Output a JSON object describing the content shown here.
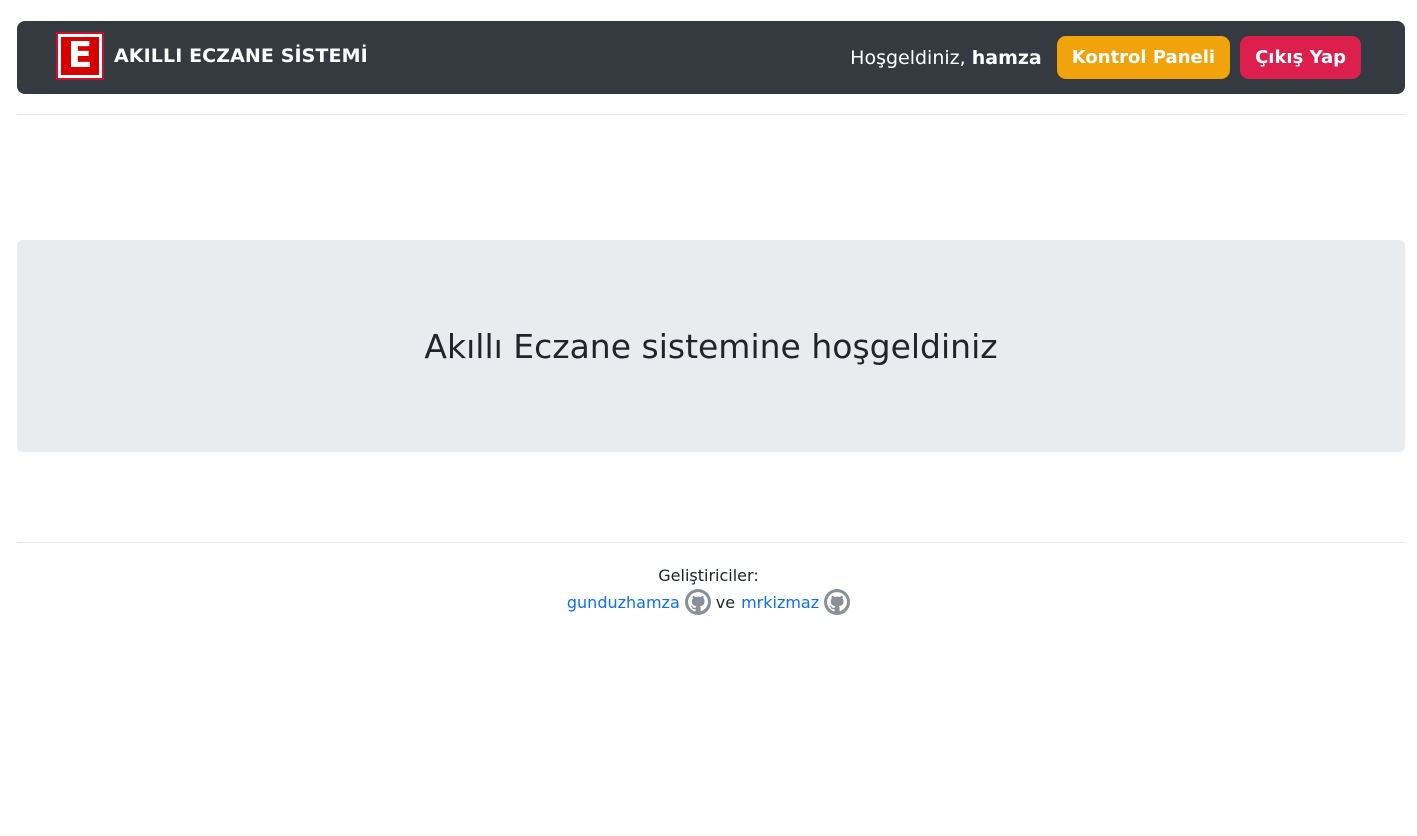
{
  "header": {
    "brand_logo_letter": "E",
    "brand_name": "AKILLI ECZANE SİSTEMİ",
    "welcome_prefix": "Hoşgeldiniz,",
    "username": "hamza",
    "dashboard_button": "Kontrol Paneli",
    "logout_button": "Çıkış Yap"
  },
  "main": {
    "heading": "Akıllı Eczane sistemine hoşgeldiniz"
  },
  "footer": {
    "developers_label": "Geliştiriciler:",
    "developer1": "gunduzhamza",
    "conjunction": "ve",
    "developer2": "mrkizmaz",
    "icon": "github-icon"
  },
  "colors": {
    "navbar_bg": "#343a40",
    "warning": "#f0a30a",
    "danger": "#dc1f4c",
    "jumbotron_bg": "#e9ecef",
    "link": "#0d6efd"
  }
}
